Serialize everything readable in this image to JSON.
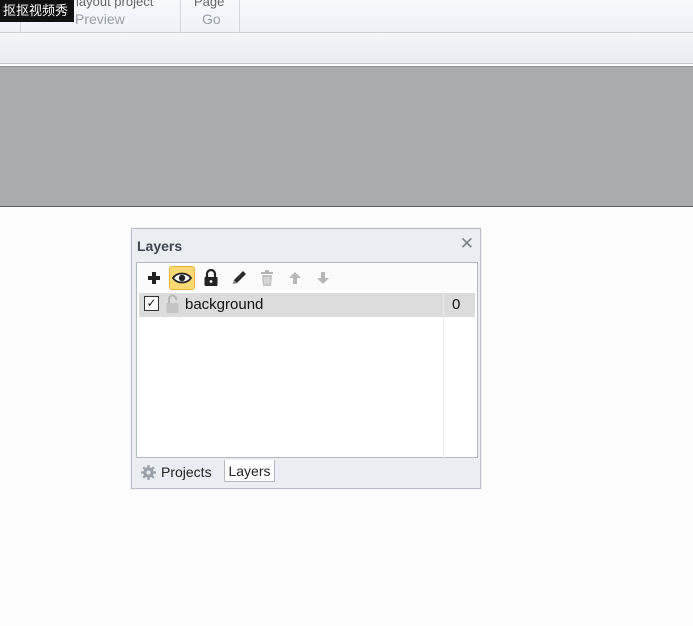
{
  "watermark": "抠抠视频秀",
  "ribbon": {
    "groups": [
      {
        "top": "layout  project",
        "bottom": "Preview"
      },
      {
        "top": "Page",
        "bottom": "Go"
      }
    ]
  },
  "layers_panel": {
    "title": "Layers",
    "close": "✕",
    "toolbar": [
      {
        "icon": "add-icon",
        "active": false
      },
      {
        "icon": "eye-icon",
        "active": true
      },
      {
        "icon": "lock-icon",
        "active": false
      },
      {
        "icon": "pencil-icon",
        "active": false
      },
      {
        "icon": "trash-icon",
        "active": false
      },
      {
        "icon": "arrow-up-icon",
        "active": false
      },
      {
        "icon": "arrow-down-icon",
        "active": false
      }
    ],
    "layers": [
      {
        "name": "background",
        "visible": true,
        "locked": false,
        "count": "0"
      }
    ],
    "tabs": [
      {
        "label": "Projects",
        "icon": "gear-icon",
        "active": false
      },
      {
        "label": "Layers",
        "active": true
      }
    ]
  }
}
